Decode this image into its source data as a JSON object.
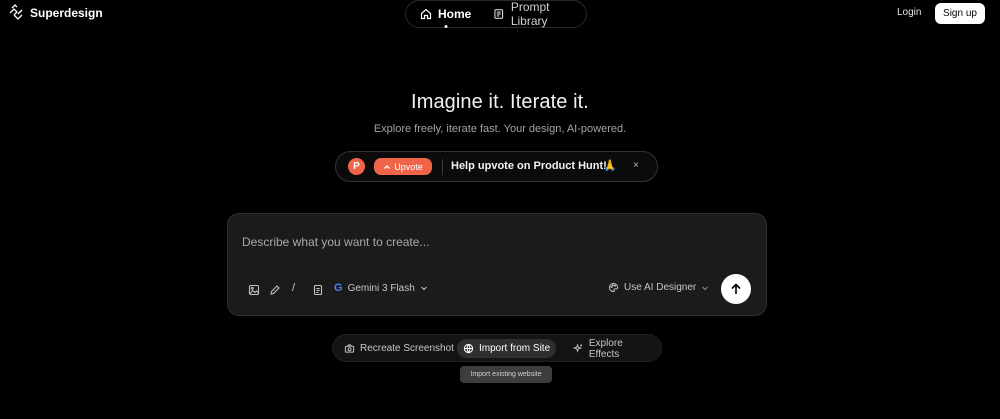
{
  "brand": {
    "name": "Superdesign"
  },
  "nav": {
    "items": [
      {
        "label": "Home",
        "icon": "home-icon",
        "active": true
      },
      {
        "label": "Prompt Library",
        "icon": "book-icon",
        "active": false
      }
    ]
  },
  "auth": {
    "login": "Login",
    "signup": "Sign up"
  },
  "hero": {
    "title": "Imagine it. Iterate it.",
    "subtitle": "Explore freely, iterate fast. Your design, AI-powered."
  },
  "banner": {
    "logo_letter": "P",
    "upvote_label": "Upvote",
    "message": "Help upvote on Product Hunt!",
    "emoji": "🙏",
    "close": "×"
  },
  "prompt": {
    "placeholder": "Describe what you want to create...",
    "slash": "/",
    "model_icon": "G",
    "model": "Gemini 3 Flash",
    "designer": "Use AI Designer"
  },
  "chips": [
    {
      "label": "Recreate Screenshot",
      "icon": "camera-icon"
    },
    {
      "label": "Import from Site",
      "icon": "globe-icon",
      "active": true
    },
    {
      "label": "Explore Effects",
      "icon": "sparkle-icon"
    }
  ],
  "tooltip": "Import existing website",
  "colors": {
    "background": "#000000",
    "producthunt": "#f06449",
    "panel": "#1b1b1b"
  }
}
